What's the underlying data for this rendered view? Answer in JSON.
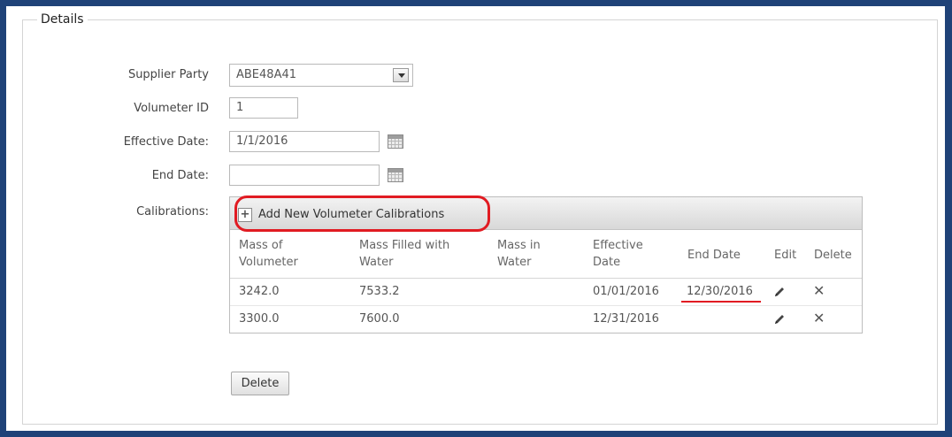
{
  "details": {
    "legend": "Details"
  },
  "form": {
    "supplier_party": {
      "label": "Supplier Party",
      "value": "ABE48A41"
    },
    "volumeter_id": {
      "label": "Volumeter ID",
      "value": "1"
    },
    "effective_date": {
      "label": "Effective Date:",
      "value": "1/1/2016"
    },
    "end_date": {
      "label": "End Date:",
      "value": ""
    },
    "calibrations": {
      "label": "Calibrations:"
    }
  },
  "calibrations_grid": {
    "add_button_label": "Add New Volumeter Calibrations",
    "columns": [
      "Mass of\nVolumeter",
      "Mass Filled with\nWater",
      "Mass in\nWater",
      "Effective\nDate",
      "End Date",
      "Edit",
      "Delete"
    ],
    "rows": [
      {
        "mass_of_volumeter": "3242.0",
        "mass_filled_with_water": "7533.2",
        "mass_in_water": "",
        "effective_date": "01/01/2016",
        "end_date": "12/30/2016"
      },
      {
        "mass_of_volumeter": "3300.0",
        "mass_filled_with_water": "7600.0",
        "mass_in_water": "",
        "effective_date": "12/31/2016",
        "end_date": ""
      }
    ]
  },
  "actions": {
    "delete_label": "Delete"
  },
  "icons": {
    "dropdown": "chevron-down-icon",
    "calendar": "calendar-icon",
    "add": "plus-icon",
    "edit": "pencil-icon",
    "delete_row": "close-icon"
  },
  "colors": {
    "frame_border": "#1f4278",
    "highlight": "#e11b22"
  }
}
